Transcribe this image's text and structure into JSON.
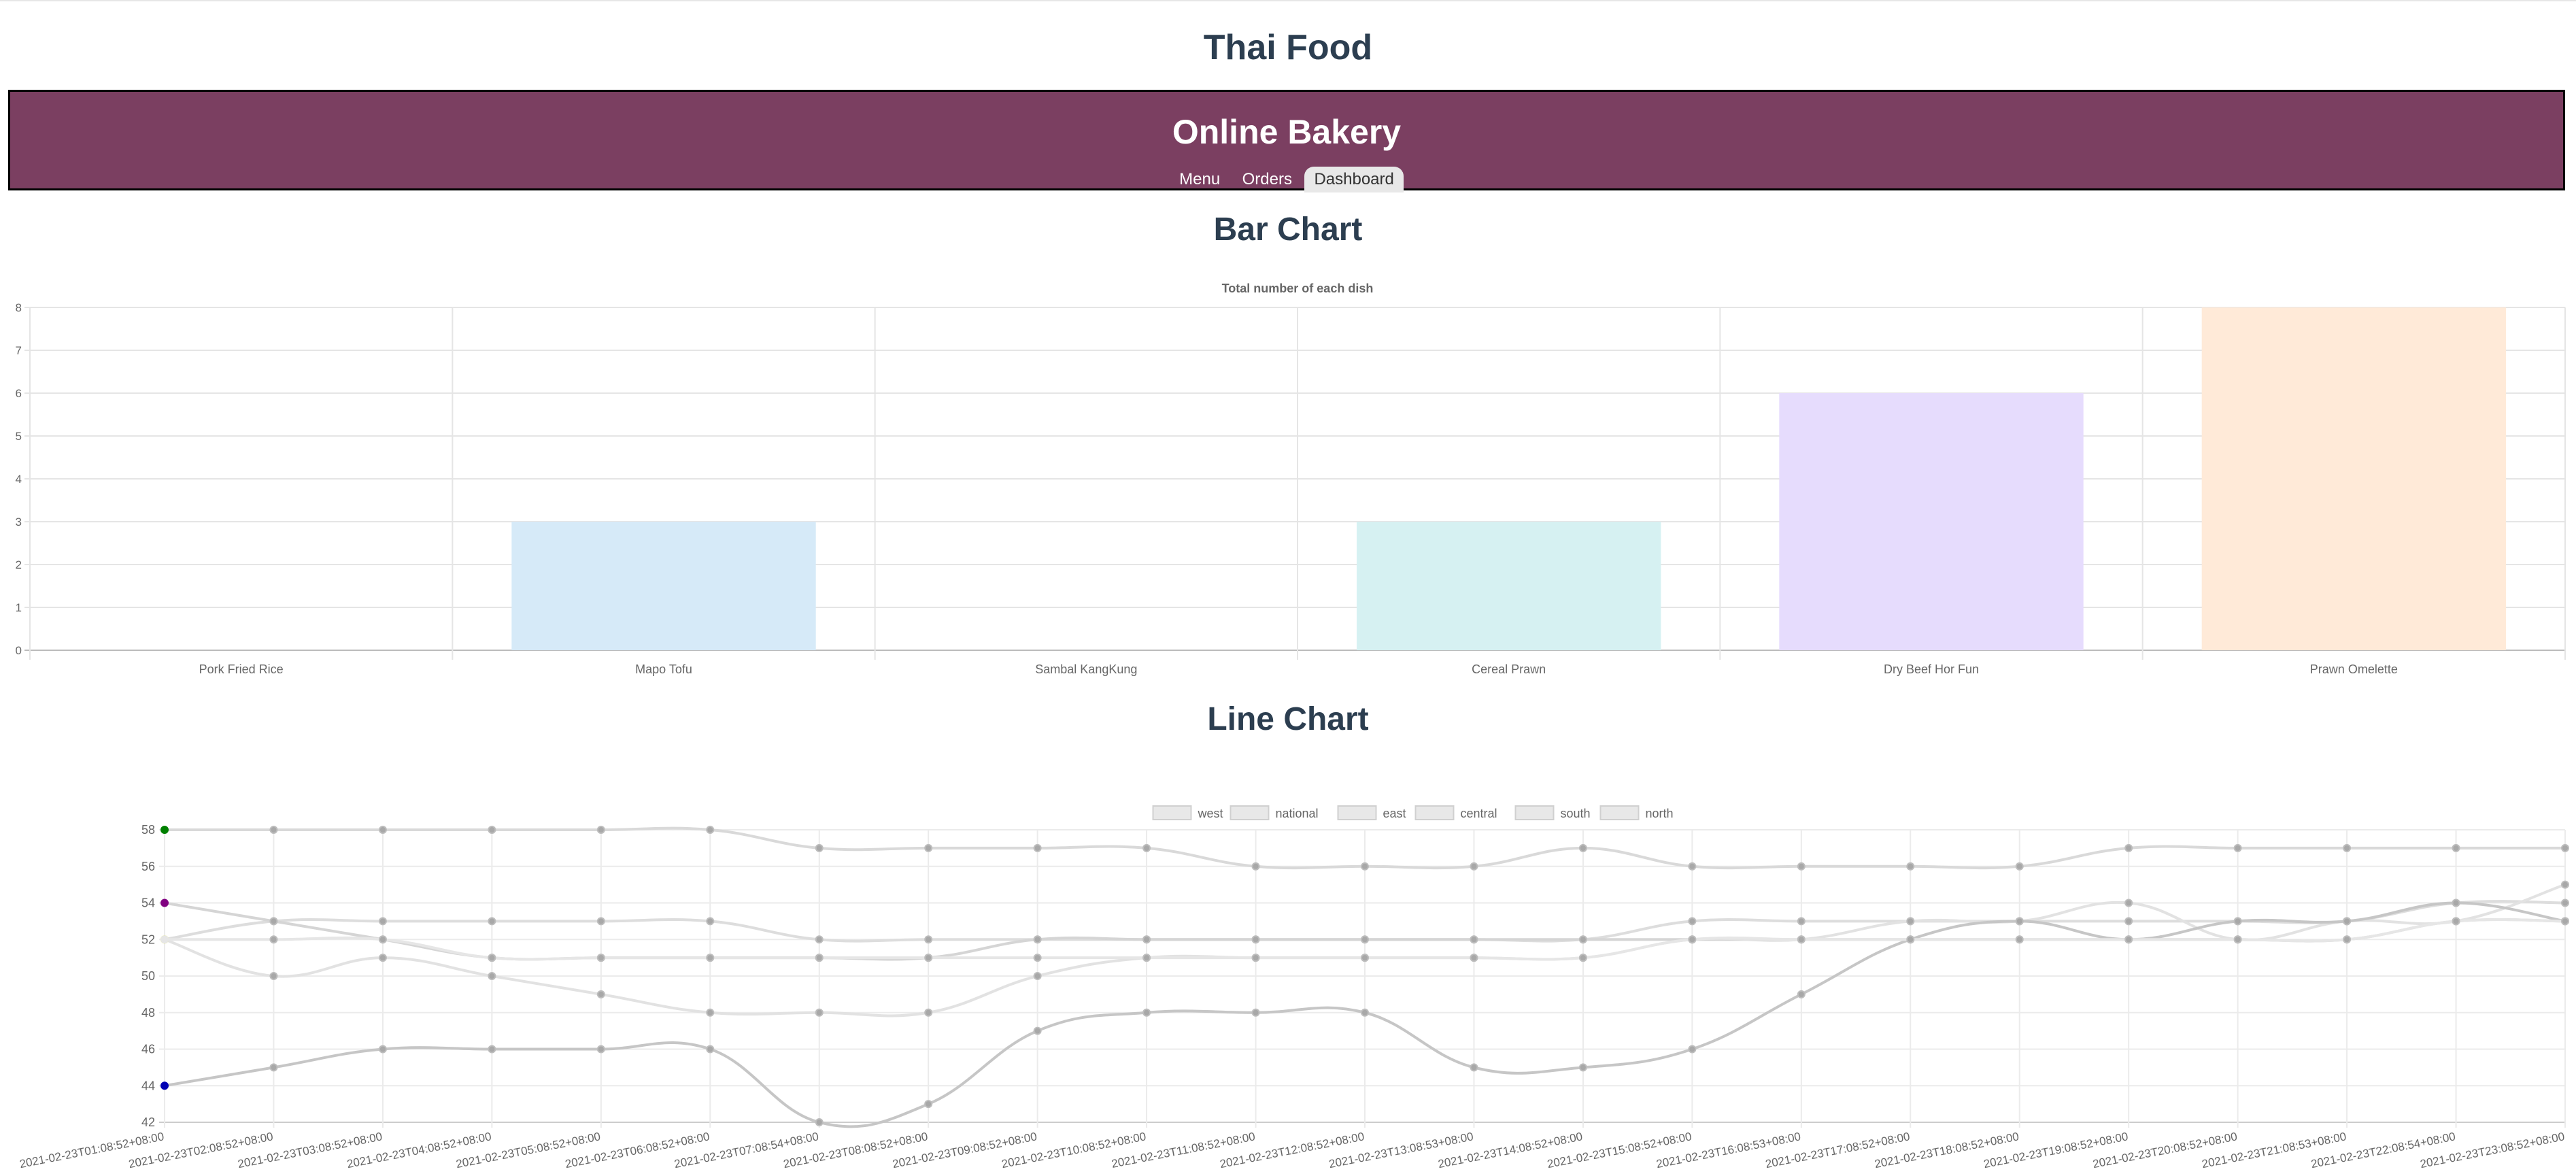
{
  "page": {
    "title": "Thai Food"
  },
  "header": {
    "brand": "Online Bakery",
    "nav": [
      {
        "label": "Menu",
        "active": false
      },
      {
        "label": "Orders",
        "active": false
      },
      {
        "label": "Dashboard",
        "active": true
      }
    ]
  },
  "sections": {
    "bar_title": "Bar Chart",
    "line_title": "Line Chart"
  },
  "colors": {
    "header_bg": "#7b3f61",
    "title_text": "#2c3e50"
  },
  "chart_data": [
    {
      "type": "bar",
      "title": "Total number of each dish",
      "categories": [
        "Pork Fried Rice",
        "Mapo Tofu",
        "Sambal KangKung",
        "Cereal Prawn",
        "Dry Beef Hor Fun",
        "Prawn Omelette"
      ],
      "values": [
        0,
        3,
        0,
        3,
        6,
        8
      ],
      "colors": [
        "#ffd6dd",
        "#d6eaf8",
        "#fff0c8",
        "#d6f1f2",
        "#e6dcfd",
        "#ffead8"
      ],
      "ylim": [
        0,
        8
      ],
      "yticks": [
        0,
        1,
        2,
        3,
        4,
        5,
        6,
        7,
        8
      ],
      "grid": true,
      "legend": "none"
    },
    {
      "type": "line",
      "x": [
        "2021-02-23T01:08:52+08:00",
        "2021-02-23T02:08:52+08:00",
        "2021-02-23T03:08:52+08:00",
        "2021-02-23T04:08:52+08:00",
        "2021-02-23T05:08:52+08:00",
        "2021-02-23T06:08:52+08:00",
        "2021-02-23T07:08:54+08:00",
        "2021-02-23T08:08:52+08:00",
        "2021-02-23T09:08:52+08:00",
        "2021-02-23T10:08:52+08:00",
        "2021-02-23T11:08:52+08:00",
        "2021-02-23T12:08:52+08:00",
        "2021-02-23T13:08:53+08:00",
        "2021-02-23T14:08:52+08:00",
        "2021-02-23T15:08:52+08:00",
        "2021-02-23T16:08:53+08:00",
        "2021-02-23T17:08:52+08:00",
        "2021-02-23T18:08:52+08:00",
        "2021-02-23T19:08:52+08:00",
        "2021-02-23T20:08:52+08:00",
        "2021-02-23T21:08:53+08:00",
        "2021-02-23T22:08:54+08:00",
        "2021-02-23T23:08:52+08:00"
      ],
      "ylim": [
        42,
        58
      ],
      "yticks": [
        42,
        44,
        46,
        48,
        50,
        52,
        54,
        56,
        58
      ],
      "grid": true,
      "legend": "top-center",
      "series": [
        {
          "name": "west",
          "color": "#d9d9d9",
          "first_point_color": "#008000",
          "values": [
            58,
            58,
            58,
            58,
            58,
            58,
            57,
            57,
            57,
            57,
            56,
            56,
            56,
            57,
            56,
            56,
            56,
            56,
            57,
            57,
            57,
            57,
            57
          ]
        },
        {
          "name": "national",
          "color": "#dddddd",
          "first_point_color": "#dddddd",
          "values": [
            52,
            53,
            53,
            53,
            53,
            53,
            52,
            52,
            52,
            52,
            52,
            52,
            52,
            52,
            53,
            53,
            53,
            53,
            53,
            53,
            53,
            54,
            54
          ]
        },
        {
          "name": "east",
          "color": "#d5d5d5",
          "first_point_color": "#800080",
          "values": [
            54,
            53,
            52,
            51,
            51,
            51,
            51,
            51,
            52,
            52,
            52,
            52,
            52,
            52,
            52,
            52,
            52,
            52,
            52,
            52,
            52,
            53,
            53
          ]
        },
        {
          "name": "central",
          "color": "#e2e2e2",
          "first_point_color": "#ffff00",
          "values": [
            52,
            50,
            51,
            50,
            49,
            48,
            48,
            48,
            50,
            51,
            51,
            51,
            51,
            51,
            52,
            52,
            53,
            53,
            54,
            52,
            53,
            53,
            55
          ]
        },
        {
          "name": "south",
          "color": "#c6c6c6",
          "first_point_color": "#0000b3",
          "values": [
            44,
            45,
            46,
            46,
            46,
            46,
            42,
            43,
            47,
            48,
            48,
            48,
            45,
            45,
            46,
            49,
            52,
            53,
            52,
            53,
            53,
            54,
            53
          ]
        },
        {
          "name": "north",
          "color": "#e6e6e6",
          "first_point_color": "#e6e6e6",
          "values": [
            52,
            52,
            52,
            51,
            51,
            51,
            51,
            51,
            51,
            51,
            51,
            51,
            51,
            51,
            52,
            52,
            52,
            52,
            52,
            52,
            52,
            53,
            53
          ]
        }
      ]
    }
  ]
}
